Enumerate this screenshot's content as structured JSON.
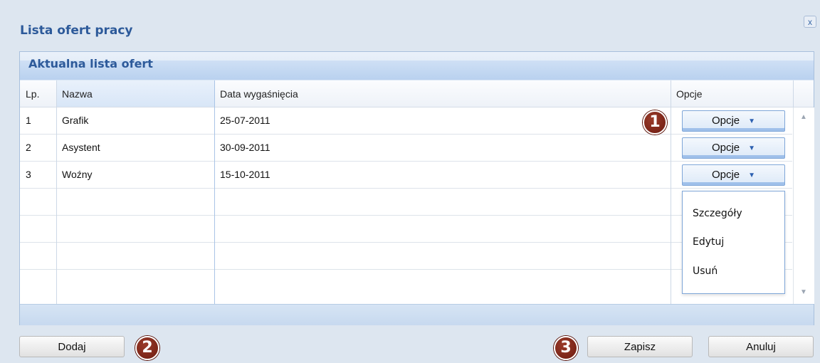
{
  "dialog": {
    "title": "Lista ofert pracy",
    "close_label": "x"
  },
  "panel": {
    "title": "Aktualna lista ofert"
  },
  "table": {
    "columns": [
      "Lp.",
      "Nazwa",
      "Data wygaśnięcia",
      "Opcje"
    ],
    "rows": [
      {
        "lp": "1",
        "nazwa": "Grafik",
        "data": "25-07-2011",
        "opcje": "Opcje"
      },
      {
        "lp": "2",
        "nazwa": "Asystent",
        "data": "30-09-2011",
        "opcje": "Opcje"
      },
      {
        "lp": "3",
        "nazwa": "Woźny",
        "data": "15-10-2011",
        "opcje": "Opcje"
      }
    ]
  },
  "dropdown": {
    "items": [
      "Szczegóły",
      "Edytuj",
      "Usuń"
    ]
  },
  "buttons": {
    "add": "Dodaj",
    "save": "Zapisz",
    "cancel": "Anuluj"
  },
  "badges": [
    "1",
    "2",
    "3"
  ],
  "colors": {
    "title": "#2d5a9a",
    "panel_header": "#b9d1ef",
    "badge": "#7a2214",
    "option_button_border": "#7fa6d8"
  }
}
